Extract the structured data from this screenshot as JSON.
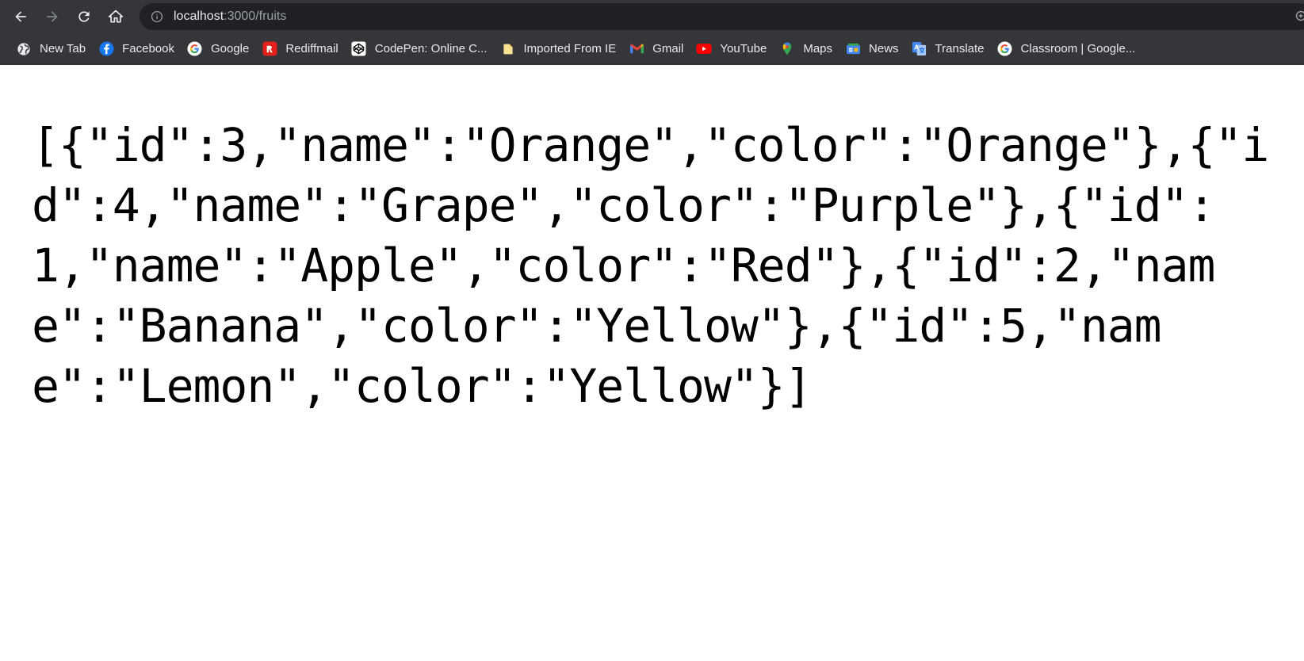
{
  "browser": {
    "url_host": "localhost",
    "url_path": ":3000/fruits",
    "nav": {
      "back_icon": "arrow-left-icon",
      "forward_icon": "arrow-right-icon",
      "reload_icon": "reload-icon",
      "home_icon": "home-icon"
    }
  },
  "bookmarks": [
    {
      "label": "New Tab",
      "icon": "globe-icon"
    },
    {
      "label": "Facebook",
      "icon": "facebook-icon"
    },
    {
      "label": "Google",
      "icon": "google-icon"
    },
    {
      "label": "Rediffmail",
      "icon": "rediffmail-icon"
    },
    {
      "label": "CodePen: Online C...",
      "icon": "codepen-icon"
    },
    {
      "label": "Imported From IE",
      "icon": "folder-icon"
    },
    {
      "label": "Gmail",
      "icon": "gmail-icon"
    },
    {
      "label": "YouTube",
      "icon": "youtube-icon"
    },
    {
      "label": "Maps",
      "icon": "maps-icon"
    },
    {
      "label": "News",
      "icon": "news-icon"
    },
    {
      "label": "Translate",
      "icon": "translate-icon"
    },
    {
      "label": "Classroom | Google...",
      "icon": "google-icon"
    }
  ],
  "page": {
    "raw_json": "[{\"id\":3,\"name\":\"Orange\",\"color\":\"Orange\"},{\"id\":4,\"name\":\"Grape\",\"color\":\"Purple\"},{\"id\":1,\"name\":\"Apple\",\"color\":\"Red\"},{\"id\":2,\"name\":\"Banana\",\"color\":\"Yellow\"},{\"id\":5,\"name\":\"Lemon\",\"color\":\"Yellow\"}]"
  },
  "colors": {
    "toolbar_bg": "#35363a",
    "omnibox_bg": "#202124",
    "facebook": "#1877f2",
    "youtube": "#ff0000"
  }
}
